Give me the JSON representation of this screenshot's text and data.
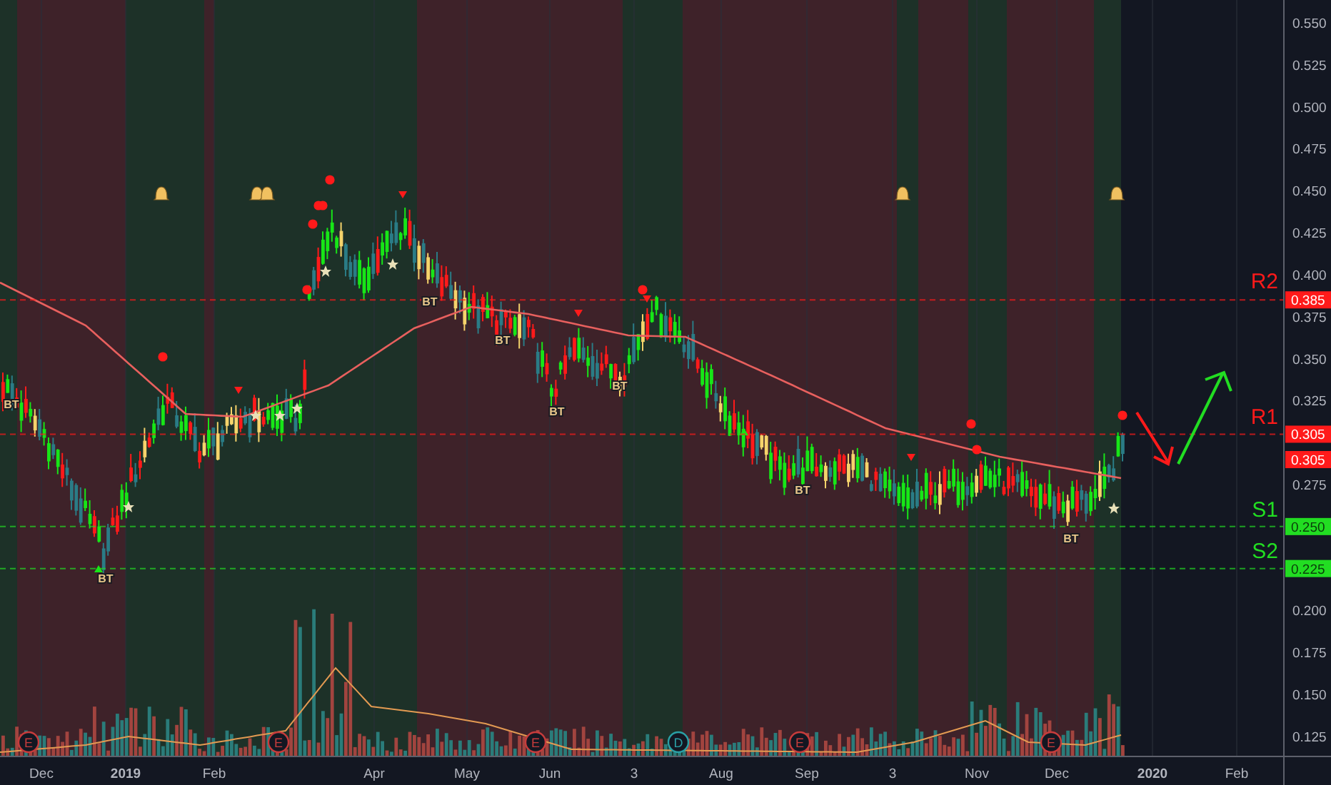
{
  "price_axis": {
    "ticks": [
      {
        "label": "0.550"
      },
      {
        "label": "0.525"
      },
      {
        "label": "0.500"
      },
      {
        "label": "0.475"
      },
      {
        "label": "0.450"
      },
      {
        "label": "0.425"
      },
      {
        "label": "0.400"
      },
      {
        "label": "0.375"
      },
      {
        "label": "0.350"
      },
      {
        "label": "0.325"
      },
      {
        "label": "0.275"
      },
      {
        "label": "0.200"
      },
      {
        "label": "0.175"
      },
      {
        "label": "0.150"
      },
      {
        "label": "0.125"
      }
    ]
  },
  "time_axis": {
    "labels": [
      "Dec",
      "2019",
      "Feb",
      "Apr",
      "May",
      "Jun",
      "3",
      "Aug",
      "Sep",
      "3",
      "Nov",
      "Dec",
      "2020",
      "Feb"
    ]
  },
  "levels": [
    {
      "label": "R2",
      "price": "0.385",
      "color": "#ff1a1a"
    },
    {
      "label": "R1",
      "price": "0.305",
      "color": "#ff1a1a"
    },
    {
      "label": "S1",
      "price": "0.250",
      "color": "#22dd22"
    },
    {
      "label": "S2",
      "price": "0.225",
      "color": "#22dd22"
    }
  ],
  "last_price_tag": {
    "price": "0.305"
  },
  "signal_labels": [
    "BT",
    "BT",
    "BT",
    "BT",
    "BT",
    "BT",
    "BT",
    "BT"
  ],
  "event_markers": [
    {
      "letter": "E",
      "kind": "earnings"
    },
    {
      "letter": "E",
      "kind": "earnings"
    },
    {
      "letter": "E",
      "kind": "earnings"
    },
    {
      "letter": "D",
      "kind": "dividend"
    },
    {
      "letter": "E",
      "kind": "earnings"
    },
    {
      "letter": "E",
      "kind": "earnings"
    }
  ]
}
